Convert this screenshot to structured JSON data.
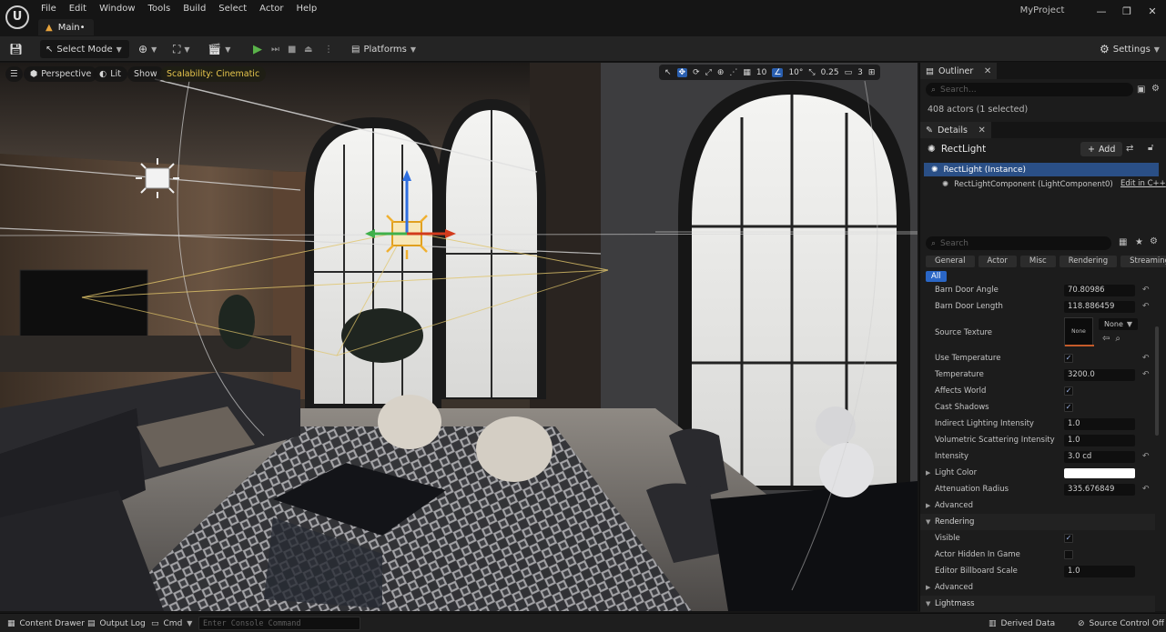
{
  "menu": {
    "logo": "U",
    "items": [
      "File",
      "Edit",
      "Window",
      "Tools",
      "Build",
      "Select",
      "Actor",
      "Help"
    ],
    "level_tab": "Main•",
    "project_name": "MyProject",
    "window_controls": [
      "—",
      "❐",
      "✕"
    ]
  },
  "toolbar": {
    "select_mode": "Select Mode",
    "platforms": "Platforms",
    "settings": "Settings"
  },
  "viewport": {
    "perspective": "Perspective",
    "lit": "Lit",
    "show": "Show",
    "scalability": "Scalability: Cinematic",
    "grid_size": "10",
    "rotation_snap": "10°",
    "scale_snap": "0.25",
    "camera_speed": "3"
  },
  "outliner": {
    "title": "Outliner",
    "search_placeholder": "Search...",
    "actor_count": "408 actors (1 selected)"
  },
  "details": {
    "title": "Details",
    "selected_actor": "RectLight",
    "add_label": "Add",
    "component_instance": "RectLight (Instance)",
    "component_child": "RectLightComponent (LightComponent0)",
    "edit_cpp": "Edit in C++",
    "search_placeholder": "Search",
    "filter_tabs": [
      "General",
      "Actor",
      "Misc",
      "Rendering",
      "Streaming"
    ],
    "all_tab": "All",
    "properties": {
      "barn_door_angle": {
        "label": "Barn Door Angle",
        "value": "70.80986"
      },
      "barn_door_length": {
        "label": "Barn Door Length",
        "value": "118.886459"
      },
      "source_texture": {
        "label": "Source Texture",
        "thumb": "None",
        "dropdown": "None"
      },
      "use_temperature": {
        "label": "Use Temperature"
      },
      "temperature": {
        "label": "Temperature",
        "value": "3200.0"
      },
      "affects_world": {
        "label": "Affects World"
      },
      "cast_shadows": {
        "label": "Cast Shadows"
      },
      "indirect_lighting": {
        "label": "Indirect Lighting Intensity",
        "value": "1.0"
      },
      "volumetric_scattering": {
        "label": "Volumetric Scattering Intensity",
        "value": "1.0"
      },
      "intensity": {
        "label": "Intensity",
        "value": "3.0 cd"
      },
      "light_color": {
        "label": "Light Color",
        "color": "#ffffff"
      },
      "attenuation_radius": {
        "label": "Attenuation Radius",
        "value": "335.676849"
      },
      "advanced_1": {
        "label": "Advanced"
      },
      "rendering_section": {
        "label": "Rendering"
      },
      "visible": {
        "label": "Visible"
      },
      "actor_hidden": {
        "label": "Actor Hidden In Game"
      },
      "billboard_scale": {
        "label": "Editor Billboard Scale",
        "value": "1.0"
      },
      "advanced_2": {
        "label": "Advanced"
      },
      "lightmass_section": {
        "label": "Lightmass"
      }
    }
  },
  "statusbar": {
    "content_drawer": "Content Drawer",
    "output_log": "Output Log",
    "cmd": "Cmd",
    "console_placeholder": "Enter Console Command",
    "derived_data": "Derived Data",
    "source_control": "Source Control Off"
  },
  "colors": {
    "accent_blue": "#2a66c6",
    "selection_blue": "#2a4f86",
    "play_green": "#5ab34a",
    "scalability_yellow": "#e7c64d"
  }
}
